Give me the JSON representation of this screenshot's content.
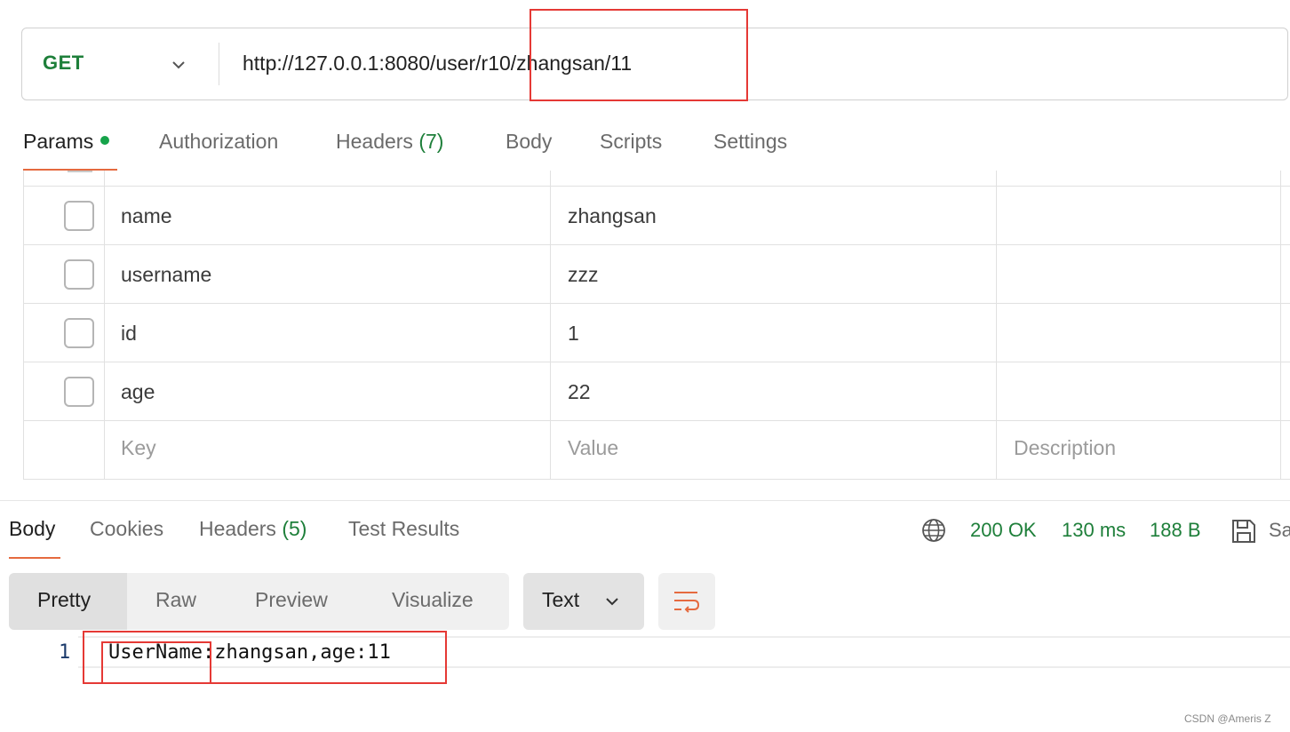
{
  "request": {
    "method": "GET",
    "url": "http://127.0.0.1:8080/user/r10/zhangsan/11"
  },
  "request_tabs": [
    {
      "label": "Params",
      "count": ""
    },
    {
      "label": "Authorization",
      "count": ""
    },
    {
      "label": "Headers",
      "count": "(7)"
    },
    {
      "label": "Body",
      "count": ""
    },
    {
      "label": "Scripts",
      "count": ""
    },
    {
      "label": "Settings",
      "count": ""
    }
  ],
  "params": {
    "rows": [
      {
        "key": "name",
        "value": "zhangsan"
      },
      {
        "key": "username",
        "value": "zzz"
      },
      {
        "key": "id",
        "value": "1"
      },
      {
        "key": "age",
        "value": "22"
      }
    ],
    "placeholders": {
      "key": "Key",
      "value": "Value",
      "description": "Description"
    }
  },
  "response_tabs": [
    {
      "label": "Body",
      "count": ""
    },
    {
      "label": "Cookies",
      "count": ""
    },
    {
      "label": "Headers",
      "count": "(5)"
    },
    {
      "label": "Test Results",
      "count": ""
    }
  ],
  "status": {
    "code": "200 OK",
    "time": "130 ms",
    "size": "188 B",
    "save_label": "Sa"
  },
  "view_modes": [
    "Pretty",
    "Raw",
    "Preview",
    "Visualize"
  ],
  "format": "Text",
  "body": {
    "line_number": "1",
    "content": "UserName:zhangsan,age:11"
  },
  "watermark": "CSDN @Ameris Z",
  "colors": {
    "accent": "#e56a3f",
    "status_green": "#1e7f3a",
    "annotation": "#e53935"
  }
}
